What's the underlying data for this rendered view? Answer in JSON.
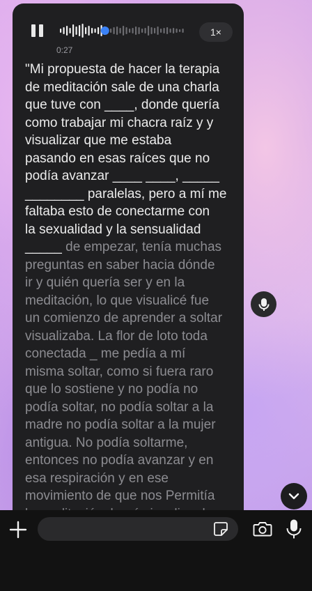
{
  "player": {
    "elapsed": "0:27",
    "speed_label": "1×",
    "progress": 0.36
  },
  "transcript": {
    "main": "\"Mi propuesta de hacer la terapia\nde meditación sale de una charla\nque tuve con ____, donde quería\ncomo trabajar mi chacra raíz y y\nvisualizar que me estaba\npasando en esas raíces que no\npodía avanzar ____ ____, _____\n________ paralelas, pero a mí me\nfaltaba esto de conectarme con\nla sexualidad y la sensualidad\n_____ ",
    "rest": "de empezar, tenía muchas\npreguntas en saber hacia dónde\nir y quién quería ser y en la\nmeditación, lo que visualicé fue\nun comienzo de aprender a soltar\nvisualizaba. La flor de loto toda\nconectada _ me pedía a mí\nmisma soltar, como si fuera raro\nque lo sostiene y no podía no\npodía soltar, no podía soltar a la\nmadre no podía soltar a la mujer\nantigua. No podía soltarme,\nentonces no podía avanzar y en\nesa respiración y en ese\nmovimiento de que nos Permitía\nla meditación, logré visualizar lo\nque tenía que soltar para seguir"
  },
  "icons": {
    "pause": "pause-icon",
    "mic_float": "microphone-icon",
    "scroll_down": "chevron-down-icon",
    "plus": "plus-icon",
    "sticker": "sticker-icon",
    "camera": "camera-icon",
    "mic": "microphone-icon"
  },
  "colors": {
    "bubble": "#1f1f21",
    "accent": "#3b82f6",
    "bottom_bar": "#121212"
  }
}
